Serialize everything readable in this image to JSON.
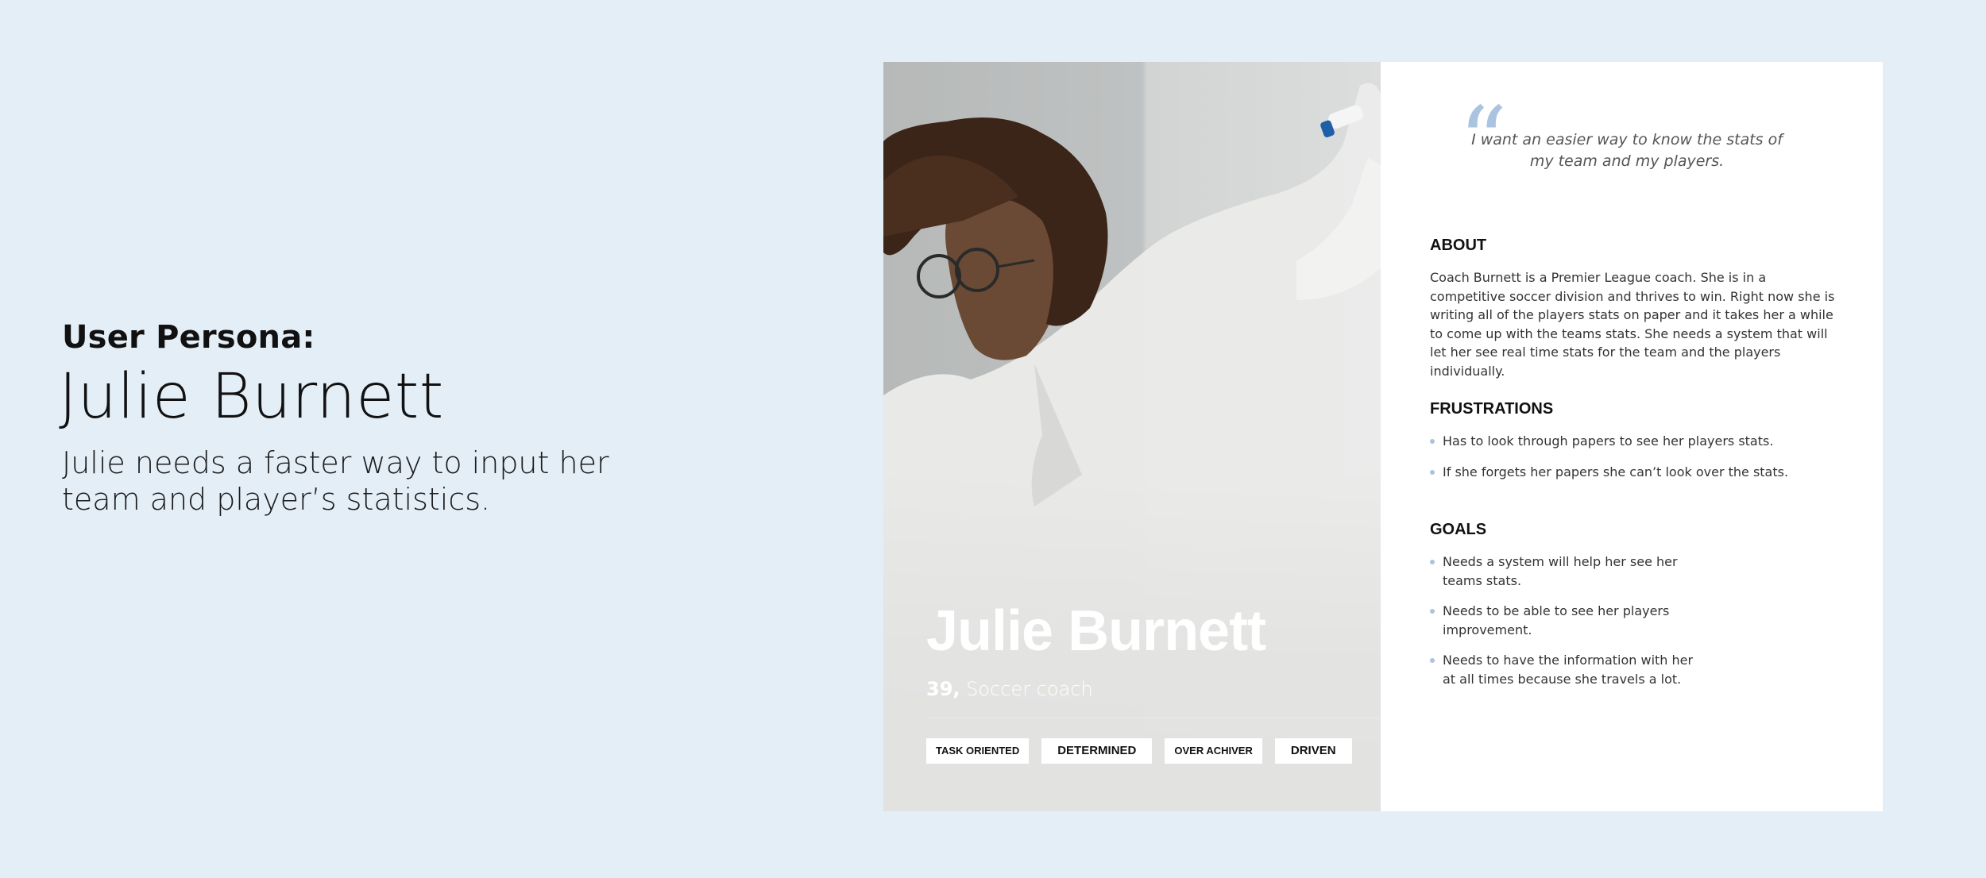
{
  "intro": {
    "kicker": "User Persona:",
    "name": "Julie Burnett",
    "summary": "Julie needs a faster way to input her team and player’s statistics."
  },
  "card": {
    "name": "Julie Burnett",
    "age": "39,",
    "role": "Soccer coach",
    "tags": [
      "TASK ORIENTED",
      "DETERMINED",
      "OVER ACHIVER",
      "DRIVEN"
    ],
    "quote": "I want an easier way to know the stats of my team and my players.",
    "about": {
      "heading": "ABOUT",
      "text": "Coach Burnett is a Premier League coach. She is in a competitive soccer division and thrives to win. Right now she is writing all of the players stats on paper and it takes her a while to come up with the teams stats.  She needs a system that will let her see real time stats for the team and the players individually."
    },
    "frustrations": {
      "heading": "FRUSTRATIONS",
      "items": [
        "Has to look through papers to see her players stats.",
        "If she forgets her papers she can’t look over the stats."
      ]
    },
    "goals": {
      "heading": "GOALS",
      "items": [
        "Needs a system will help her see her teams stats.",
        "Needs to be able to see her players improvement.",
        "Needs to have the information with her at all times because she travels a lot."
      ]
    }
  },
  "colors": {
    "background": "#e4eef7",
    "accent": "#aac4e0"
  },
  "icons": {
    "quote": "quote-mark-icon",
    "bullet": "bullet-dot-icon"
  }
}
